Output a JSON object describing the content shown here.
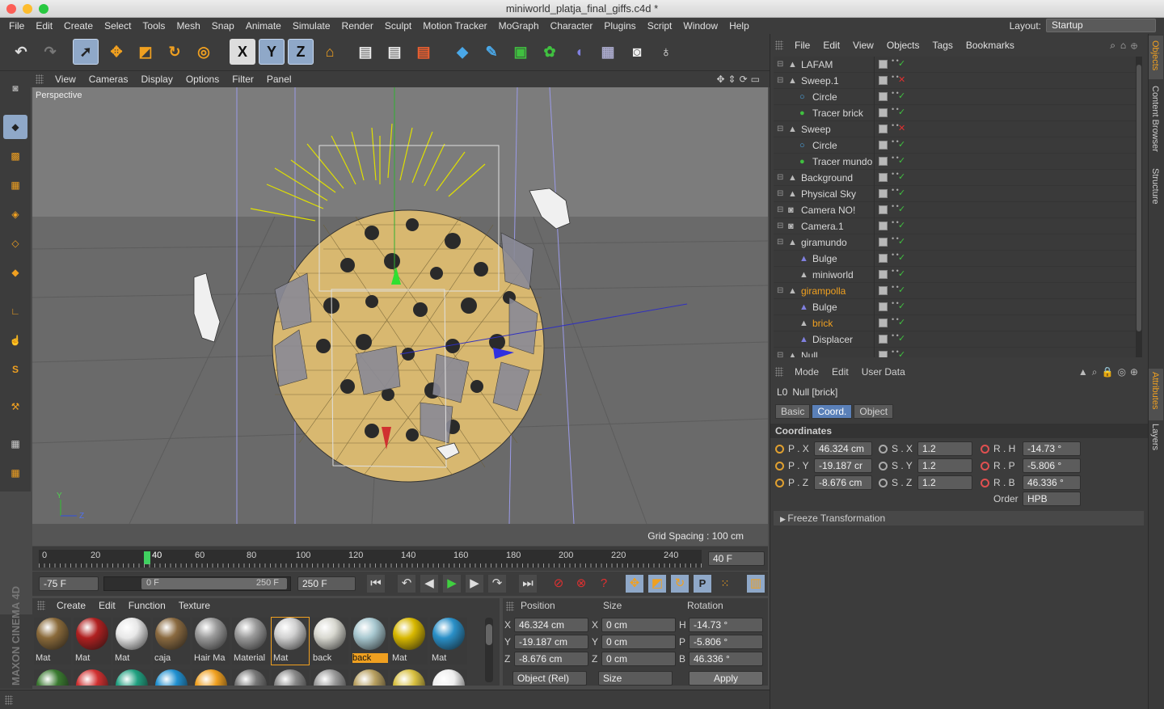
{
  "window": {
    "title": "miniworld_platja_final_giffs.c4d *"
  },
  "menu": [
    "File",
    "Edit",
    "Create",
    "Select",
    "Tools",
    "Mesh",
    "Snap",
    "Animate",
    "Simulate",
    "Render",
    "Sculpt",
    "Motion Tracker",
    "MoGraph",
    "Character",
    "Plugins",
    "Script",
    "Window",
    "Help"
  ],
  "layout": {
    "label": "Layout:",
    "value": "Startup"
  },
  "toolbar": {
    "x_label": "X",
    "y_label": "Y",
    "z_label": "Z"
  },
  "viewport": {
    "menu": [
      "View",
      "Cameras",
      "Display",
      "Options",
      "Filter",
      "Panel"
    ],
    "name": "Perspective",
    "grid_spacing": "Grid Spacing : 100 cm",
    "axis_y": "Y",
    "axis_z": "Z"
  },
  "timeline": {
    "ticks": [
      "0",
      "20",
      "40",
      "60",
      "80",
      "100",
      "120",
      "140",
      "160",
      "180",
      "200",
      "220",
      "240"
    ],
    "current_frame_marker": "40",
    "frame_field": "40 F"
  },
  "transport": {
    "start": "-75 F",
    "range_start": "0 F",
    "range_end": "250 F",
    "end": "250 F"
  },
  "materials": {
    "menu": [
      "Create",
      "Edit",
      "Function",
      "Texture"
    ],
    "items": [
      {
        "label": "Mat",
        "color": "#8a6a3a"
      },
      {
        "label": "Mat",
        "color": "#b02020"
      },
      {
        "label": "Mat",
        "color": "#e8e8e8"
      },
      {
        "label": "caja",
        "color": "#8a6a40"
      },
      {
        "label": "Hair Ma",
        "color": "#9a9a9a"
      },
      {
        "label": "Material",
        "color": "#9a9a9a"
      },
      {
        "label": "Mat",
        "color": "#d0d0d0"
      },
      {
        "label": "back",
        "color": "#d8d8d0"
      },
      {
        "label": "back",
        "color": "#a8c8d0"
      },
      {
        "label": "Mat",
        "color": "#d8b800"
      },
      {
        "label": "Mat",
        "color": "#2a90c8"
      }
    ],
    "brand": "MAXON CINEMA 4D"
  },
  "coord_manager": {
    "headers": {
      "position": "Position",
      "size": "Size",
      "rotation": "Rotation"
    },
    "rows": [
      {
        "axis": "X",
        "pos": "46.324 cm",
        "saxis": "X",
        "size": "0 cm",
        "raxis": "H",
        "rot": "-14.73 °"
      },
      {
        "axis": "Y",
        "pos": "-19.187 cm",
        "saxis": "Y",
        "size": "0 cm",
        "raxis": "P",
        "rot": "-5.806 °"
      },
      {
        "axis": "Z",
        "pos": "-8.676 cm",
        "saxis": "Z",
        "size": "0 cm",
        "raxis": "B",
        "rot": "46.336 °"
      }
    ],
    "mode": "Object (Rel)",
    "size_mode": "Size",
    "apply": "Apply"
  },
  "objects": {
    "menu": [
      "File",
      "Edit",
      "View",
      "Objects",
      "Tags",
      "Bookmarks"
    ],
    "rows": [
      {
        "name": "LAFAM",
        "indent": 0,
        "orange": false
      },
      {
        "name": "Sweep.1",
        "indent": 0,
        "orange": false
      },
      {
        "name": "Circle",
        "indent": 1,
        "orange": false
      },
      {
        "name": "Tracer brick",
        "indent": 1,
        "orange": false
      },
      {
        "name": "Sweep",
        "indent": 0,
        "orange": false
      },
      {
        "name": "Circle",
        "indent": 1,
        "orange": false
      },
      {
        "name": "Tracer mundo",
        "indent": 1,
        "orange": false
      },
      {
        "name": "Background",
        "indent": 0,
        "orange": false
      },
      {
        "name": "Physical Sky",
        "indent": 0,
        "orange": false
      },
      {
        "name": "Camera NO!",
        "indent": 0,
        "orange": false
      },
      {
        "name": "Camera.1",
        "indent": 0,
        "orange": false
      },
      {
        "name": "giramundo",
        "indent": 0,
        "orange": false
      },
      {
        "name": "Bulge",
        "indent": 1,
        "orange": false
      },
      {
        "name": "miniworld",
        "indent": 1,
        "orange": false
      },
      {
        "name": "girampolla",
        "indent": 0,
        "orange": true
      },
      {
        "name": "Bulge",
        "indent": 1,
        "orange": false
      },
      {
        "name": "brick",
        "indent": 1,
        "orange": true
      },
      {
        "name": "Displacer",
        "indent": 1,
        "orange": false
      },
      {
        "name": "Null",
        "indent": 0,
        "orange": false
      }
    ]
  },
  "attributes": {
    "menu": [
      "Mode",
      "Edit",
      "User Data"
    ],
    "object_title": "Null [brick]",
    "tabs": [
      "Basic",
      "Coord.",
      "Object"
    ],
    "active_tab": "Coord.",
    "section": "Coordinates",
    "rows": [
      {
        "p": "P . X",
        "pv": "46.324 cm",
        "s": "S . X",
        "sv": "1.2",
        "r": "R . H",
        "rv": "-14.73 °"
      },
      {
        "p": "P . Y",
        "pv": "-19.187 cr",
        "s": "S . Y",
        "sv": "1.2",
        "r": "R . P",
        "rv": "-5.806 °"
      },
      {
        "p": "P . Z",
        "pv": "-8.676 cm",
        "s": "S . Z",
        "sv": "1.2",
        "r": "R . B",
        "rv": "46.336 °"
      }
    ],
    "order_label": "Order",
    "order_value": "HPB",
    "freeze": "Freeze Transformation"
  },
  "side_tabs": [
    "Objects",
    "Content Browser",
    "Structure",
    "Attributes",
    "Layers"
  ]
}
